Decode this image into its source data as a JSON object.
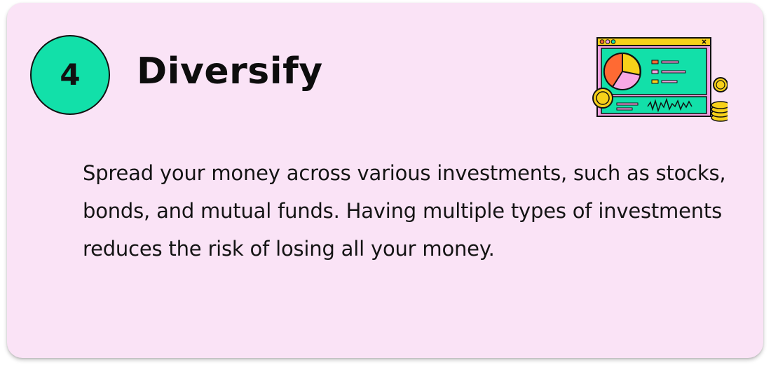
{
  "step": {
    "number": "4",
    "title": "Diversify"
  },
  "description": "Spread your money across various investments, such as stocks, bonds, and mutual funds. Having multiple types of investments reduces the risk of losing all your money.",
  "colors": {
    "card_background": "#fae3f6",
    "badge_fill": "#12e0a9",
    "text": "#111111",
    "screen_green": "#12e0a9",
    "coin_yellow": "#f7d11a",
    "pie_orange": "#ff6a33",
    "pie_pink": "#f7a8e6"
  },
  "illustration": {
    "icons": [
      "browser-window-icon",
      "pie-chart-icon",
      "line-graph-icon",
      "coin-icon",
      "coin-stack-icon"
    ]
  }
}
